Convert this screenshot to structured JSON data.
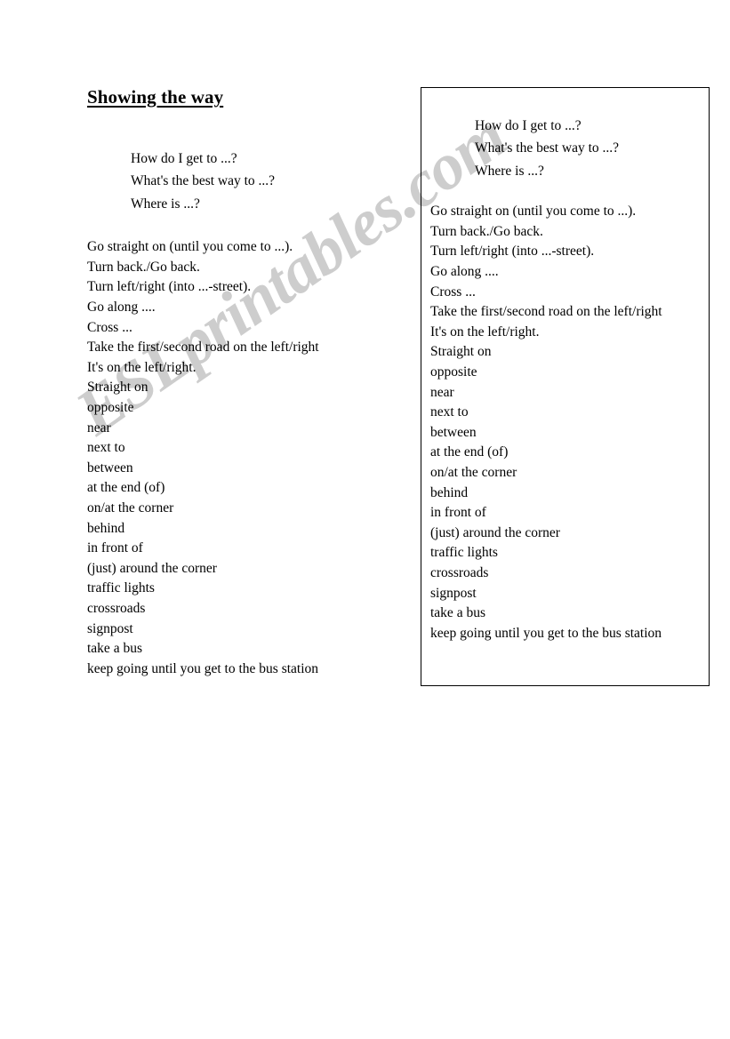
{
  "document": {
    "title": "Showing the way"
  },
  "questions": [
    "How do I get to ...?",
    "What's the best way to ...?",
    "Where is ...?"
  ],
  "phrases": [
    "Go straight on (until you come to ...).",
    "Turn back./Go back.",
    "Turn left/right (into ...-street).",
    "Go along ....",
    "Cross ...",
    "Take the first/second road on the left/right",
    "It's on the left/right.",
    "Straight on",
    "opposite",
    "near",
    "next to",
    "between",
    "at the end (of)",
    "on/at the corner",
    "behind",
    "in front of",
    "(just) around the corner",
    "traffic lights",
    "crossroads",
    "signpost",
    "take a bus",
    "keep going until you get to the bus station"
  ],
  "watermark": {
    "text": "ESLprintables.com",
    "color": "#cdcdcd"
  },
  "colors": {
    "page_background": "#ffffff",
    "text": "#000000",
    "box_border": "#000000"
  }
}
